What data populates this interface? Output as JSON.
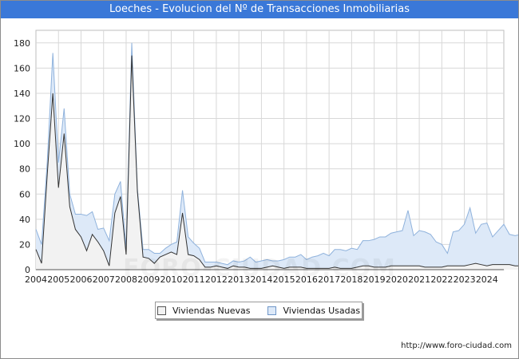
{
  "title": "Loeches - Evolucion del Nº de Transacciones Inmobiliarias",
  "source": "http://www.foro-ciudad.com",
  "watermark": "FORO-CIUDAD.COM",
  "colors": {
    "title_bg": "#3a78d8",
    "nuevas_fill": "#f2f2f2",
    "nuevas_line": "#333333",
    "usadas_fill": "#dde9f8",
    "usadas_line": "#8fb2dc",
    "grid": "#d8d8d8"
  },
  "chart_data": {
    "type": "area",
    "title": "Loeches - Evolucion del Nº de Transacciones Inmobiliarias",
    "xlabel": "",
    "ylabel": "",
    "x_start": 2004,
    "x_step": 0.25,
    "xlim": [
      2004,
      2024.75
    ],
    "ylim": [
      0,
      190
    ],
    "y_ticks": [
      0,
      20,
      40,
      60,
      80,
      100,
      120,
      140,
      160,
      180
    ],
    "x_ticks": [
      "2004",
      "2005",
      "2006",
      "2007",
      "2008",
      "2009",
      "2010",
      "2011",
      "2012",
      "2013",
      "2014",
      "2015",
      "2016",
      "2017",
      "2018",
      "2019",
      "2020",
      "2021",
      "2022",
      "2023",
      "2024"
    ],
    "grid": true,
    "legend_position": "bottom",
    "stacked": true,
    "series": [
      {
        "name": "Viviendas Nuevas",
        "values": [
          16,
          5,
          75,
          140,
          65,
          108,
          50,
          32,
          26,
          15,
          28,
          22,
          15,
          3,
          45,
          58,
          12,
          170,
          62,
          10,
          9,
          5,
          10,
          12,
          14,
          12,
          45,
          12,
          11,
          8,
          2,
          2,
          3,
          2,
          1,
          3,
          2,
          2,
          1,
          1,
          1,
          2,
          3,
          2,
          1,
          2,
          2,
          2,
          1,
          1,
          1,
          1,
          1,
          2,
          1,
          1,
          1,
          2,
          3,
          3,
          2,
          2,
          2,
          3,
          3,
          3,
          3,
          3,
          3,
          2,
          2,
          2,
          2,
          3,
          3,
          3,
          3,
          4,
          5,
          4,
          3,
          4,
          4,
          4,
          4,
          3,
          3,
          1,
          10,
          4,
          1,
          3,
          2
        ]
      },
      {
        "name": "Viviendas Usadas",
        "values": [
          16,
          15,
          10,
          32,
          20,
          20,
          10,
          12,
          18,
          28,
          18,
          10,
          18,
          20,
          15,
          12,
          5,
          10,
          2,
          6,
          7,
          8,
          3,
          5,
          6,
          10,
          18,
          14,
          10,
          9,
          4,
          4,
          3,
          3,
          3,
          4,
          4,
          5,
          9,
          5,
          6,
          6,
          4,
          5,
          7,
          8,
          8,
          10,
          7,
          9,
          10,
          12,
          10,
          14,
          15,
          14,
          16,
          14,
          20,
          20,
          22,
          24,
          24,
          26,
          27,
          28,
          44,
          24,
          28,
          28,
          26,
          20,
          18,
          10,
          27,
          28,
          33,
          45,
          24,
          32,
          34,
          22,
          27,
          32,
          24,
          24,
          25,
          23,
          26,
          32,
          15,
          28,
          18
        ]
      }
    ]
  },
  "legend": {
    "items": [
      "Viviendas Nuevas",
      "Viviendas Usadas"
    ]
  }
}
